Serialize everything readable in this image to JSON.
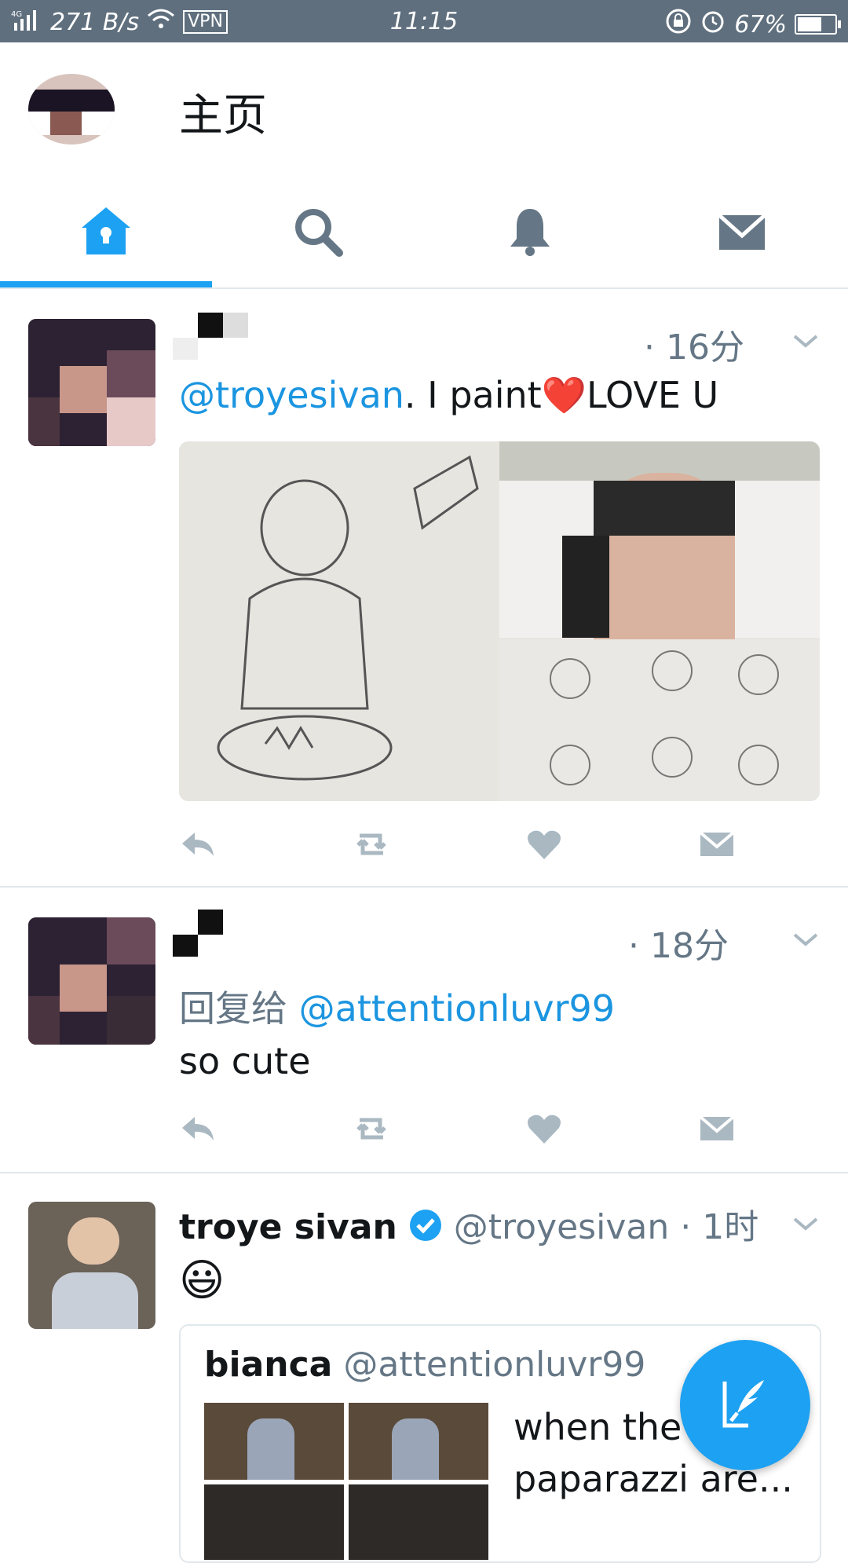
{
  "status_bar": {
    "network": "4G",
    "speed": "271 B/s",
    "vpn": "VPN",
    "time": "11:15",
    "battery": "67%"
  },
  "header": {
    "title": "主页"
  },
  "tabs": [
    {
      "name": "home",
      "icon": "home-icon",
      "active": true
    },
    {
      "name": "search",
      "icon": "search-icon",
      "active": false
    },
    {
      "name": "notifications",
      "icon": "bell-icon",
      "active": false
    },
    {
      "name": "messages",
      "icon": "mail-icon",
      "active": false
    }
  ],
  "tweets": [
    {
      "time": "· 16分",
      "mention": "@troyesivan",
      "text": ".  I paint❤️LOVE U"
    },
    {
      "time": "· 18分",
      "reply_prefix": "回复给",
      "reply_to": "@attentionluvr99",
      "text": "so cute"
    },
    {
      "name": "troye sivan",
      "handle": "@troyesivan",
      "time": "· 1时",
      "text": "😃",
      "quote": {
        "name": "bianca",
        "handle": "@attentionluvr99",
        "text_line1": "when the",
        "text_line2": "paparazzi are..."
      }
    }
  ],
  "colors": {
    "accent": "#1da1f2",
    "statusbar": "#5f6f7e",
    "icon_gray": "#aab8c2"
  }
}
